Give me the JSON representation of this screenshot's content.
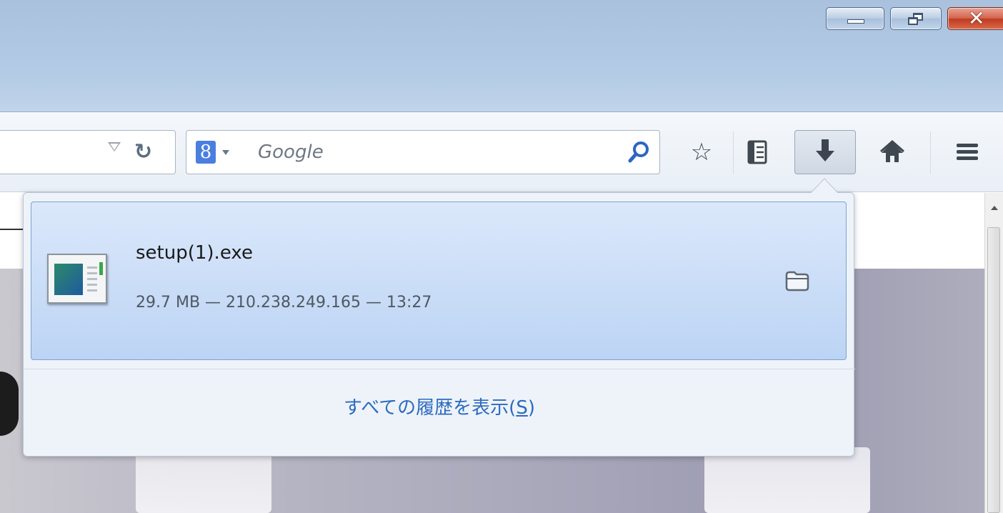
{
  "window": {
    "controls": {
      "minimize": "minimize",
      "maximize": "restore",
      "close": "close"
    }
  },
  "toolbar": {
    "search": {
      "placeholder": "Google",
      "engine_icon": "google-icon",
      "engine_glyph": "8"
    },
    "icons": [
      "dropmarker-icon",
      "reload-icon",
      "search-go-icon",
      "bookmark-star-icon",
      "bookmarks-list-icon",
      "download-icon",
      "home-icon",
      "menu-icon"
    ]
  },
  "downloads_panel": {
    "items": [
      {
        "file_name": "setup(1).exe",
        "size": "29.7 MB",
        "source": "210.238.249.165",
        "time": "13:27",
        "meta": "29.7 MB — 210.238.249.165 — 13:27",
        "icon": "exe-file-icon",
        "action_icon": "open-folder-icon"
      }
    ],
    "show_all_history": {
      "label_prefix": "すべての履歴を表示(",
      "access_key": "S",
      "label_suffix": ")"
    }
  },
  "colors": {
    "titlebar": "#b2cae5",
    "item_selected": "#c6dbf6",
    "link": "#2c6bbd",
    "close_button": "#c9472c"
  }
}
